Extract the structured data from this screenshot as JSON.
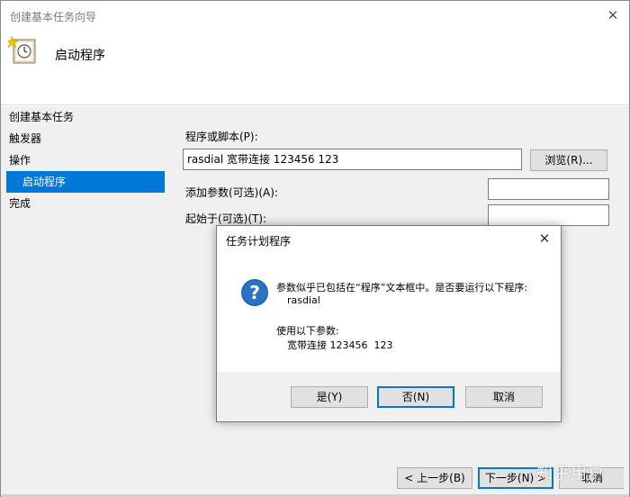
{
  "window": {
    "title": "创建基本任务向导",
    "heading": "启动程序"
  },
  "nav": {
    "items": [
      {
        "label": "创建基本任务",
        "sub": false,
        "selected": false
      },
      {
        "label": "触发器",
        "sub": false,
        "selected": false
      },
      {
        "label": "操作",
        "sub": false,
        "selected": false
      },
      {
        "label": "启动程序",
        "sub": true,
        "selected": true
      },
      {
        "label": "完成",
        "sub": false,
        "selected": false
      }
    ]
  },
  "form": {
    "program_label": "程序或脚本(P):",
    "program_value": "rasdial 宽带连接 123456  123",
    "browse_label": "浏览(R)...",
    "args_label": "添加参数(可选)(A):",
    "args_value": "",
    "start_label": "起始于(可选)(T):",
    "start_value": ""
  },
  "wizard_buttons": {
    "back": "< 上一步(B)",
    "next": "下一步(N) >",
    "cancel": "取消"
  },
  "dialog": {
    "title": "任务计划程序",
    "line1": "参数似乎已包括在“程序”文本框中。是否要运行以下程序:",
    "line2": "rasdial",
    "line3": "使用以下参数:",
    "line4": "宽带连接 123456  123",
    "yes": "是(Y)",
    "no": "否(N)",
    "cancel": "取消"
  },
  "watermark": "知乎用户",
  "colors": {
    "accent": "#0078d7",
    "body_bg": "#f0f0f0"
  }
}
